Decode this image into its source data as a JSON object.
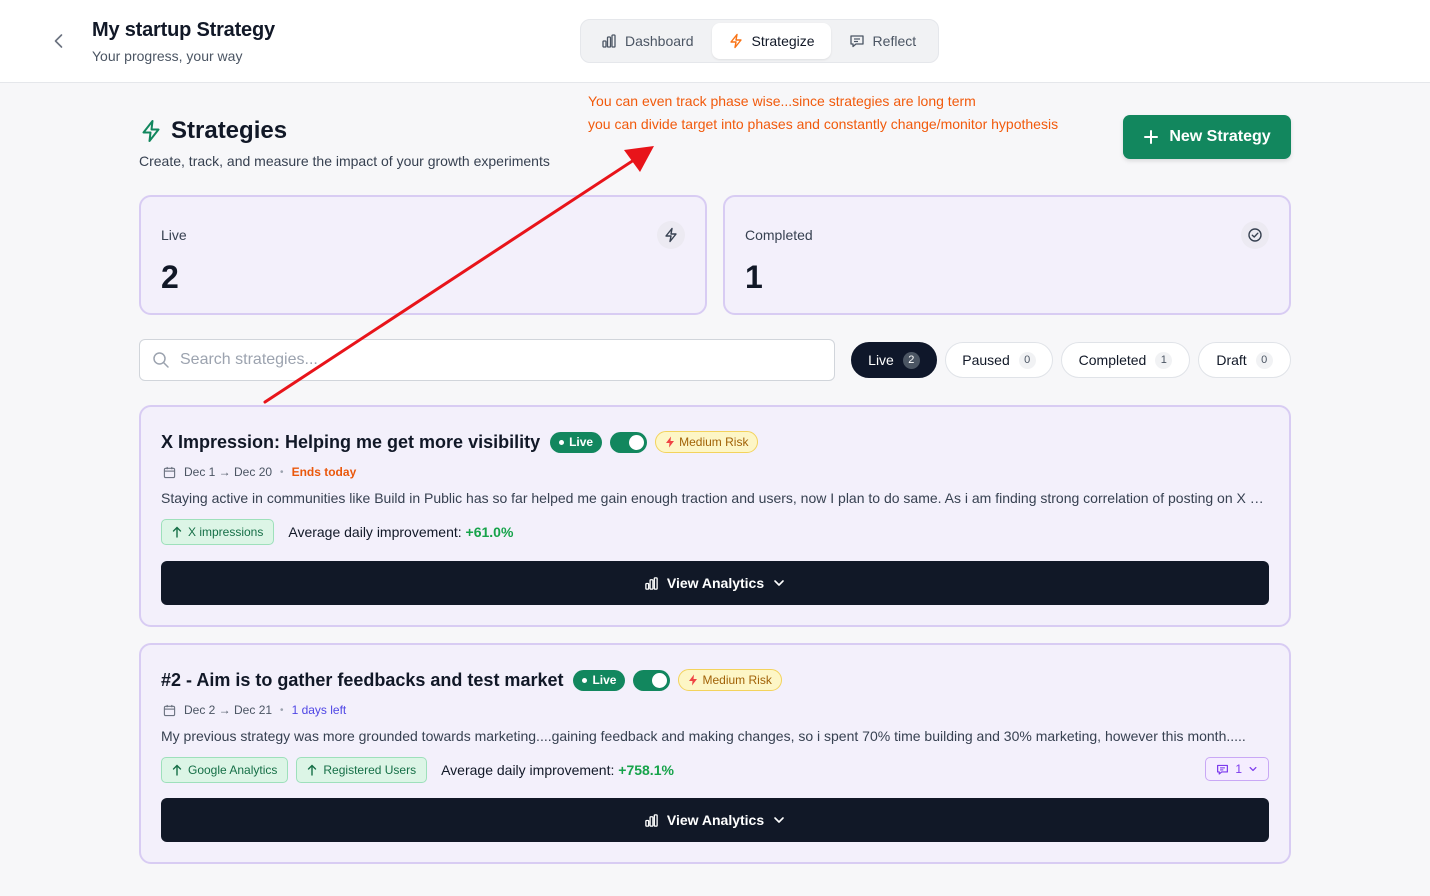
{
  "header": {
    "title": "My startup Strategy",
    "subtitle": "Your progress, your way",
    "tabs": [
      {
        "label": "Dashboard",
        "icon": "bar-chart-icon",
        "active": false
      },
      {
        "label": "Strategize",
        "icon": "lightning-icon",
        "active": true
      },
      {
        "label": "Reflect",
        "icon": "message-icon",
        "active": false
      }
    ]
  },
  "annotation": {
    "line1": "You can even track phase wise...since strategies are long term",
    "line2": "you can divide target into phases and constantly change/monitor hypothesis",
    "color": "#f15a0c",
    "arrow_color": "#e8141a"
  },
  "page": {
    "title": "Strategies",
    "subtitle": "Create, track, and measure the impact of your growth experiments",
    "new_button": "New Strategy",
    "accent": "#12875e"
  },
  "stats": [
    {
      "label": "Live",
      "value": "2",
      "icon": "lightning-icon"
    },
    {
      "label": "Completed",
      "value": "1",
      "icon": "check-circle-icon"
    }
  ],
  "search": {
    "placeholder": "Search strategies..."
  },
  "filters": [
    {
      "label": "Live",
      "count": "2",
      "active": true
    },
    {
      "label": "Paused",
      "count": "0",
      "active": false
    },
    {
      "label": "Completed",
      "count": "1",
      "active": false
    },
    {
      "label": "Draft",
      "count": "0",
      "active": false
    }
  ],
  "strategies": [
    {
      "title": "X Impression: Helping me get more visibility",
      "status": "Live",
      "enabled": true,
      "risk": "Medium Risk",
      "dates": "Dec 1 → Dec 20",
      "deadline": "Ends today",
      "deadline_color": "#ea580c",
      "description": "Staying active in communities like Build in Public has so far helped me gain enough traction and users, now I plan to do same. As i am finding strong correlation of posting on X and getting more users, I want to",
      "metrics": [
        "X impressions"
      ],
      "avg_label": "Average daily improvement:",
      "avg_value": "+61.0%",
      "button": "View Analytics"
    },
    {
      "title": "#2 - Aim is to gather feedbacks and test market",
      "status": "Live",
      "enabled": true,
      "risk": "Medium Risk",
      "dates": "Dec 2 → Dec 21",
      "deadline": "1 days left",
      "deadline_color": "#4f46e5",
      "description": "My previous strategy was more grounded towards marketing....gaining feedback and making changes, so i spent 70% time building and 30% marketing, however this month.....",
      "metrics": [
        "Google Analytics",
        "Registered Users"
      ],
      "avg_label": "Average daily improvement:",
      "avg_value": "+758.1%",
      "comments": "1",
      "button": "View Analytics"
    }
  ]
}
